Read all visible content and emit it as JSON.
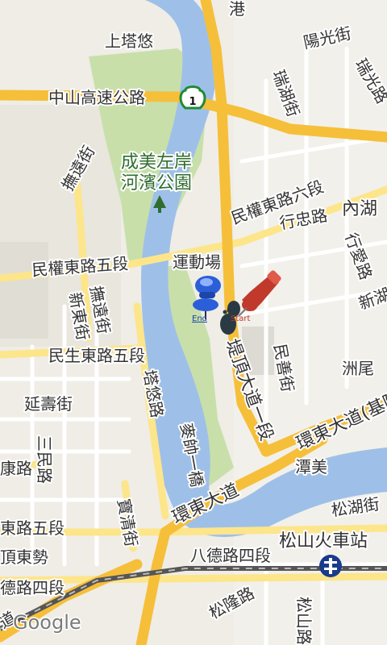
{
  "map": {
    "labels": {
      "shang_ta_you": "上塔悠",
      "zhongshan_freeway": "中山高速公路",
      "highway_shield_number": "1",
      "gang": "港",
      "ruihu_st": "瑞湖街",
      "yangguang_st": "陽光街",
      "ruiguang_rd": "瑞光路",
      "neihu": "內湖",
      "chengmei_park_1": "成美左岸",
      "chengmei_park_2": "河濱公園",
      "fuyuan_st_top": "撫遠街",
      "minquan_e6": "民權東路六段",
      "xingzhong_rd": "行忠路",
      "xingai_rd": "行愛路",
      "xinhu": "新湖",
      "minquan_e5": "民權東路五段",
      "yundongchang": "運動場",
      "xindong_st": "新東街",
      "fuyuan_st_mid": "撫遠街",
      "minsheng_e5": "民生東路五段",
      "yanshou_st": "延壽街",
      "tayou_rd": "塔悠路",
      "tiding_ave": "堤頂大道一段",
      "minshan_st": "民善街",
      "zhouwei": "洲尾",
      "huandong_ave": "環東大道(基隆",
      "sanmin_rd": "三民路",
      "kang_rd": "康路",
      "keelung_bridge": "麥帥一橋",
      "tanmei": "潭美",
      "huandong_ave_2": "環東大道",
      "songhu_st": "松湖街",
      "dong_rd5": "東路五段",
      "baoqing_st": "寶清街",
      "songshan_station": "松山火車站",
      "dingdong_shi": "頂東勢",
      "bade_rd4": "八德路四段",
      "de_rd4": "德路四段",
      "keelung_rd": "松隆路",
      "songshan_rd": "松山路",
      "dao": "道"
    },
    "pins": {
      "end_label": "End",
      "start_label": "Start"
    },
    "attribution": "Google",
    "colors": {
      "background": "#efede6",
      "water": "#9ec0e8",
      "park": "#c8dfaa",
      "highway": "#f6bf3a",
      "major_road": "#fde58a",
      "minor_road": "#ffffff",
      "rail": "#555555",
      "end_pin": "#2b5fd9",
      "start_pin": "#c0392b"
    }
  }
}
